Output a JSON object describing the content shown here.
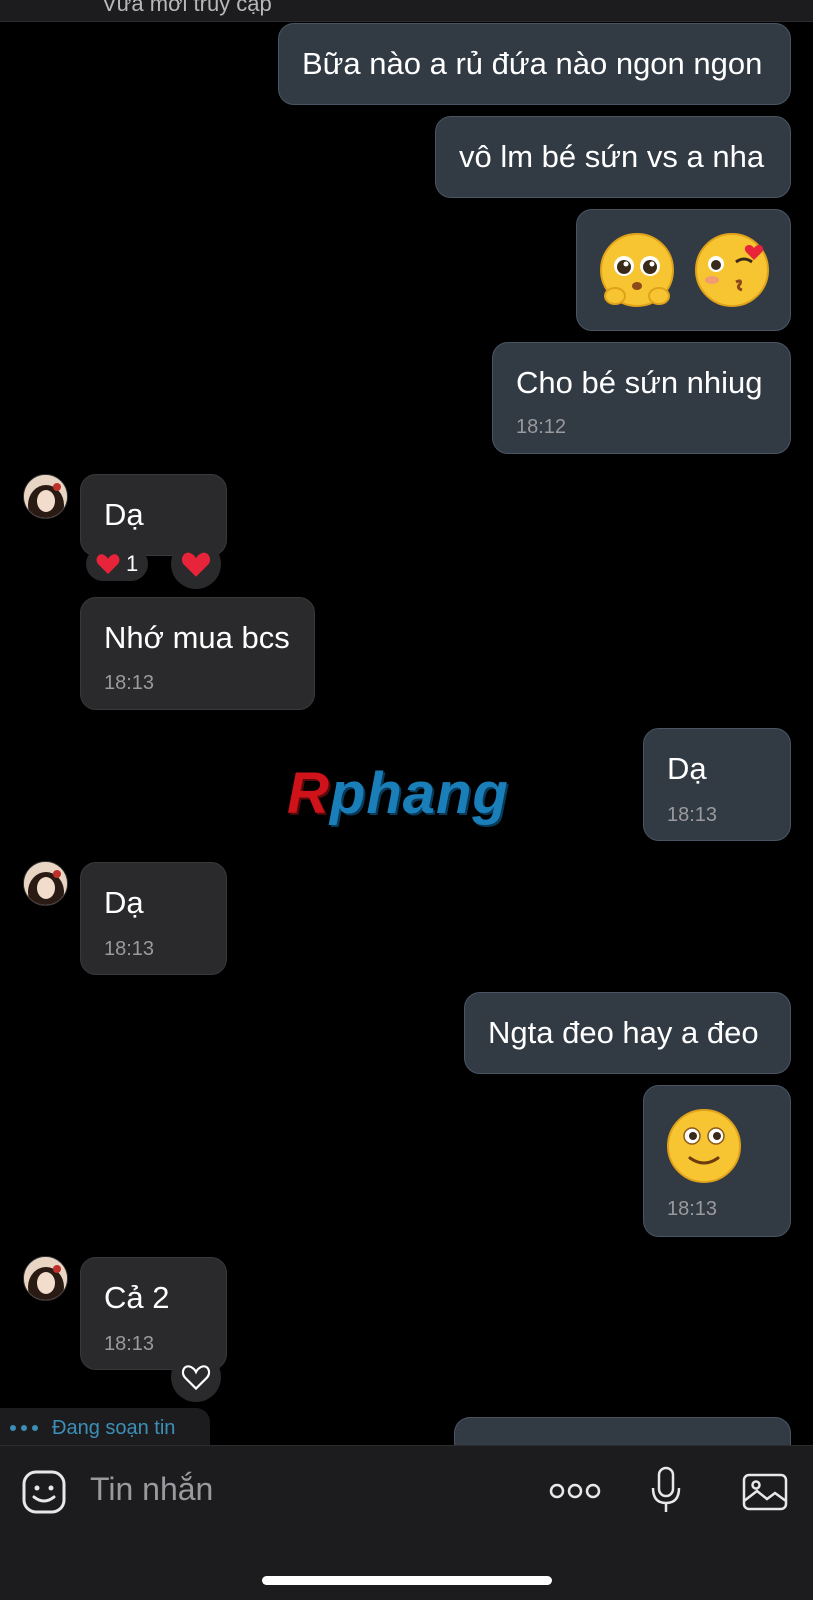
{
  "header": {
    "last_active": "Vừa mới truy cập"
  },
  "messages": {
    "m1": "Bữa nào a rủ đứa nào ngon ngon",
    "m2": "vô lm bé sứn vs a nha",
    "m4": "Cho bé sứn nhiug",
    "m4_time": "18:12",
    "m5": "Dạ",
    "m5_reaction_count": "1",
    "m6": "Nhớ mua bcs",
    "m6_time": "18:13",
    "m7": "Dạ",
    "m7_time": "18:13",
    "m8": "Dạ",
    "m8_time": "18:13",
    "m9": "Ngta đeo hay a đeo",
    "m10_time": "18:13",
    "m11": "Cả 2",
    "m11_time": "18:13"
  },
  "watermark": {
    "first": "R",
    "rest": "phang"
  },
  "typing": {
    "label": "Đang soạn tin"
  },
  "input": {
    "placeholder": "Tin nhắn"
  },
  "icons": {
    "sticker": "sticker-icon",
    "more": "more-icon",
    "mic": "microphone-icon",
    "image": "image-icon",
    "heart": "heart-icon"
  },
  "colors": {
    "my_bubble": "#323a44",
    "their_bubble": "#2a2a2c",
    "accent": "#3c8fb8",
    "reaction_heart": "#e8243a"
  }
}
